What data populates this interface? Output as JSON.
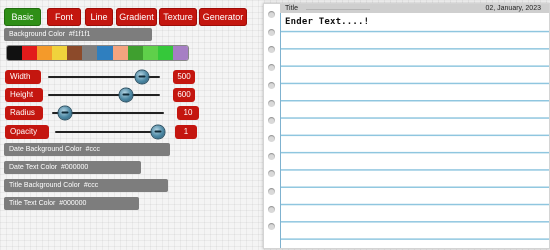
{
  "tabs": [
    {
      "label": "Basic",
      "active": true
    },
    {
      "label": "Font",
      "active": false
    },
    {
      "label": "Line",
      "active": false
    },
    {
      "label": "Gradient",
      "active": false
    },
    {
      "label": "Texture",
      "active": false
    },
    {
      "label": "Generator",
      "active": false
    }
  ],
  "background_color": {
    "label": "Background Color",
    "value": "#f1f1f1"
  },
  "swatches": [
    "#111111",
    "#e21b1b",
    "#f49a2a",
    "#f0d23c",
    "#8c4a2a",
    "#7f7f7f",
    "#2f7fbf",
    "#f4a47f",
    "#3f9f2f",
    "#5fd04a",
    "#35c83a",
    "#a67fc4"
  ],
  "sliders": [
    {
      "label": "Width",
      "value": "500",
      "fraction": 0.84
    },
    {
      "label": "Height",
      "value": "600",
      "fraction": 0.7
    },
    {
      "label": "Radius",
      "value": "10",
      "fraction": 0.12
    },
    {
      "label": "Opacity",
      "value": "1",
      "fraction": 0.99
    }
  ],
  "date_bg_color": {
    "label": "Date Background Color",
    "value": "#ccc"
  },
  "date_text_color": {
    "label": "Date Text Color",
    "value": "#000000"
  },
  "title_bg_color": {
    "label": "Title Background Color",
    "value": "#ccc"
  },
  "title_text_color": {
    "label": "Title Text Color",
    "value": "#000000"
  },
  "notebook": {
    "title": "Title",
    "date": "02, January, 2023",
    "text": "Ender Text....!"
  },
  "colors": {
    "accent_red": "#c4160f",
    "active_green": "#2f8f17",
    "label_grey": "#7d7d7d",
    "ruled_line": "#8fc6df"
  }
}
